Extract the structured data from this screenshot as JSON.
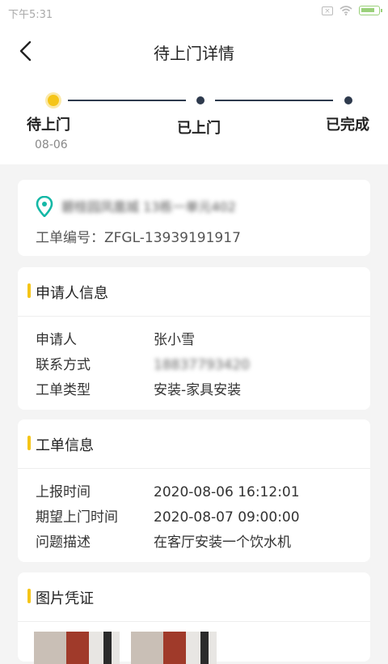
{
  "status_bar": {
    "time": "下午5:31"
  },
  "header": {
    "title": "待上门详情"
  },
  "progress": {
    "steps": [
      {
        "label": "待上门",
        "date": "08-06"
      },
      {
        "label": "已上门"
      },
      {
        "label": "已完成"
      }
    ]
  },
  "location": {
    "address": "碧桂园凤凰城 13栋一单元402",
    "work_order_no": "工单编号：ZFGL-13939191917"
  },
  "applicant": {
    "title": "申请人信息",
    "rows": [
      {
        "label": "申请人",
        "value": "张小雪"
      },
      {
        "label": "联系方式",
        "value": "18837793420"
      },
      {
        "label": "工单类型",
        "value": "安装-家具安装"
      }
    ]
  },
  "order": {
    "title": "工单信息",
    "rows": [
      {
        "label": "上报时间",
        "value": "2020-08-06 16:12:01"
      },
      {
        "label": "期望上门时间",
        "value": "2020-08-07 09:00:00"
      },
      {
        "label": "问题描述",
        "value": "在客厅安装一个饮水机"
      }
    ]
  },
  "photos": {
    "title": "图片凭证"
  },
  "colors": {
    "accent": "#f5c518",
    "pin": "#14b8a6",
    "dark": "#2e3a4d"
  }
}
